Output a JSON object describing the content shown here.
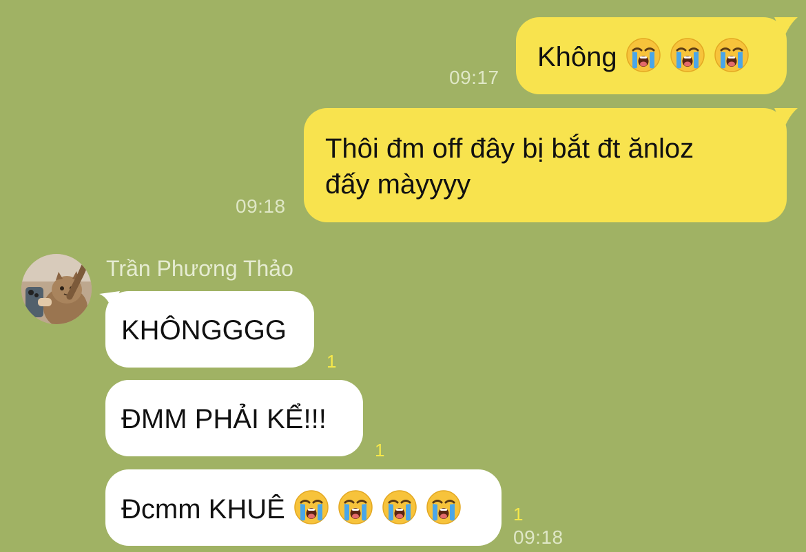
{
  "colors": {
    "background": "#a0b264",
    "outgoing_bubble": "#f8e34e",
    "incoming_bubble": "#ffffff",
    "timestamp": "#dfe7c6",
    "read_count": "#f6e84a"
  },
  "messages_out": [
    {
      "text": "Không",
      "emoji": [
        "loudly-crying-face",
        "loudly-crying-face",
        "loudly-crying-face"
      ],
      "time": "09:17"
    },
    {
      "line1": "Thôi đm off đây bị bắt đt ănloz",
      "line2": "đấy màyyyy",
      "time": "09:18"
    }
  ],
  "contact": {
    "name": "Trần Phương Thảo",
    "avatar": "cat-photo-avatar"
  },
  "messages_in": [
    {
      "text": "KHÔNGGGG",
      "unread": "1"
    },
    {
      "text": "ĐMM PHẢI KỂ!!!",
      "unread": "1"
    },
    {
      "text": "Đcmm KHUÊ",
      "emoji": [
        "loudly-crying-face",
        "loudly-crying-face",
        "loudly-crying-face",
        "loudly-crying-face"
      ],
      "unread": "1",
      "time": "09:18"
    }
  ]
}
